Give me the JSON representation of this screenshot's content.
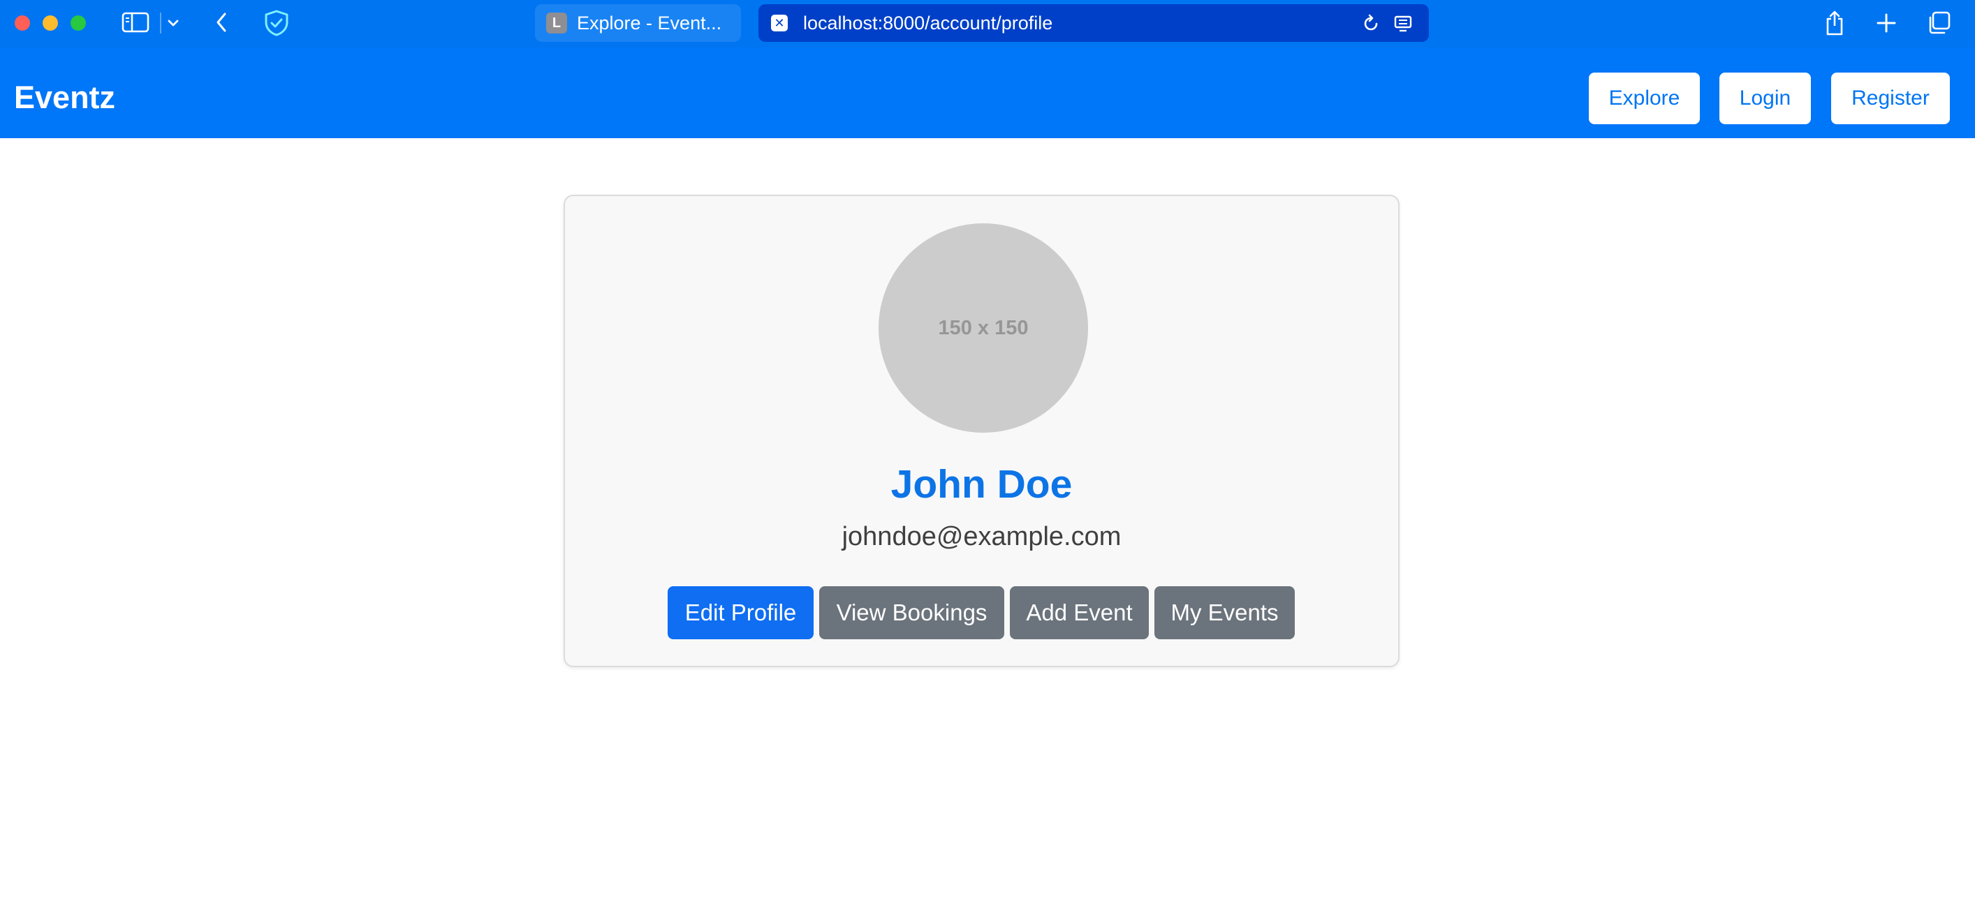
{
  "browser": {
    "tab_favicon_letter": "L",
    "tab_title": "Explore - Event...",
    "address_favicon": "✕",
    "url": "localhost:8000/account/profile",
    "icons": [
      "sidebar-icon",
      "chevron-down-icon",
      "back-icon",
      "shield-icon",
      "reload-icon",
      "reader-icon",
      "share-icon",
      "new-tab-icon",
      "tabs-overview-icon"
    ]
  },
  "navbar": {
    "brand": "Eventz",
    "links": {
      "explore": "Explore",
      "login": "Login",
      "register": "Register"
    }
  },
  "profile": {
    "avatar_placeholder": "150 x 150",
    "name": "John Doe",
    "email": "johndoe@example.com",
    "actions": {
      "edit_profile": "Edit Profile",
      "view_bookings": "View Bookings",
      "add_event": "Add Event",
      "my_events": "My Events"
    }
  },
  "colors": {
    "chrome": "#0075f2",
    "navbar": "#0076f8",
    "primary": "#0f6ef1",
    "secondary": "#6b737c",
    "name": "#0d74e6"
  }
}
